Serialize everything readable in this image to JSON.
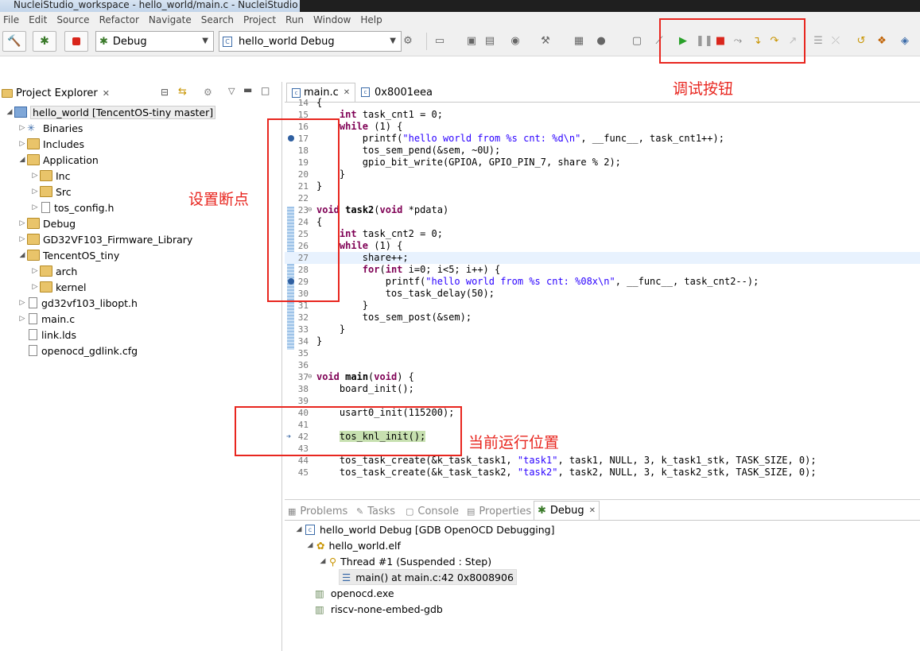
{
  "window": {
    "title": "NucleiStudio_workspace - hello_world/main.c - NucleiStudio"
  },
  "menu": [
    "File",
    "Edit",
    "Source",
    "Refactor",
    "Navigate",
    "Search",
    "Project",
    "Run",
    "Window",
    "Help"
  ],
  "toolbar": {
    "launch_mode": "Debug",
    "launch_config": "hello_world Debug",
    "icons": [
      "hammer-icon",
      "bug-icon",
      "stop-icon",
      "new-icon",
      "save-icon",
      "save-all-icon",
      "globe-icon",
      "build-icon",
      "binary-icon",
      "person-icon",
      "console-icon",
      "skip-breakpoints-icon",
      "resume-icon",
      "suspend-icon",
      "terminate-icon",
      "disconnect-icon",
      "step-into-icon",
      "step-over-icon",
      "step-return-icon",
      "instruction-step-icon",
      "drop-frame-icon",
      "restart-icon",
      "module-icon",
      "new-class-icon"
    ]
  },
  "explorer": {
    "title": "Project Explorer",
    "items": [
      {
        "label": "hello_world [TencentOS-tiny master]",
        "icon": "project"
      },
      {
        "label": "Binaries",
        "icon": "binaries"
      },
      {
        "label": "Includes",
        "icon": "includes"
      },
      {
        "label": "Application",
        "icon": "folder"
      },
      {
        "label": "Inc",
        "icon": "folder"
      },
      {
        "label": "Src",
        "icon": "folder"
      },
      {
        "label": "tos_config.h",
        "icon": "file"
      },
      {
        "label": "Debug",
        "icon": "folder"
      },
      {
        "label": "GD32VF103_Firmware_Library",
        "icon": "folder"
      },
      {
        "label": "TencentOS_tiny",
        "icon": "folder"
      },
      {
        "label": "arch",
        "icon": "folder"
      },
      {
        "label": "kernel",
        "icon": "folder"
      },
      {
        "label": "gd32vf103_libopt.h",
        "icon": "file"
      },
      {
        "label": "main.c",
        "icon": "file"
      },
      {
        "label": "link.lds",
        "icon": "file"
      },
      {
        "label": "openocd_gdlink.cfg",
        "icon": "file"
      }
    ]
  },
  "editor": {
    "tabs": [
      {
        "label": "main.c",
        "active": true
      },
      {
        "label": "0x8001eea",
        "active": false
      }
    ],
    "lines": [
      {
        "n": "14",
        "t": "{"
      },
      {
        "n": "15",
        "t": "    int task_cnt1 = 0;"
      },
      {
        "n": "16",
        "t": "    while (1) {"
      },
      {
        "n": "17",
        "t": "        printf(\"hello world from %s cnt: %d\\n\", __func__, task_cnt1++);"
      },
      {
        "n": "18",
        "t": "        tos_sem_pend(&sem, ~0U);"
      },
      {
        "n": "19",
        "t": "        gpio_bit_write(GPIOA, GPIO_PIN_7, share % 2);"
      },
      {
        "n": "20",
        "t": "    }"
      },
      {
        "n": "21",
        "t": "}"
      },
      {
        "n": "22",
        "t": ""
      },
      {
        "n": "23",
        "t": "void task2(void *pdata)"
      },
      {
        "n": "24",
        "t": "{"
      },
      {
        "n": "25",
        "t": "    int task_cnt2 = 0;"
      },
      {
        "n": "26",
        "t": "    while (1) {"
      },
      {
        "n": "27",
        "t": "        share++;"
      },
      {
        "n": "28",
        "t": "        for(int i=0; i<5; i++) {"
      },
      {
        "n": "29",
        "t": "            printf(\"hello world from %s cnt: %08x\\n\", __func__, task_cnt2--);"
      },
      {
        "n": "30",
        "t": "            tos_task_delay(50);"
      },
      {
        "n": "31",
        "t": "        }"
      },
      {
        "n": "32",
        "t": "        tos_sem_post(&sem);"
      },
      {
        "n": "33",
        "t": "    }"
      },
      {
        "n": "34",
        "t": "}"
      },
      {
        "n": "35",
        "t": ""
      },
      {
        "n": "36",
        "t": ""
      },
      {
        "n": "37",
        "t": "void main(void) {"
      },
      {
        "n": "38",
        "t": "    board_init();"
      },
      {
        "n": "39",
        "t": ""
      },
      {
        "n": "40",
        "t": "    usart0_init(115200);"
      },
      {
        "n": "41",
        "t": ""
      },
      {
        "n": "42",
        "t": "    tos_knl_init();"
      },
      {
        "n": "43",
        "t": ""
      },
      {
        "n": "44",
        "t": "    tos_task_create(&k_task_task1, \"task1\", task1, NULL, 3, k_task1_stk, TASK_SIZE, 0);"
      },
      {
        "n": "45",
        "t": "    tos_task_create(&k_task_task2, \"task2\", task2, NULL, 3, k_task2_stk, TASK_SIZE, 0);"
      }
    ]
  },
  "bottom": {
    "tabs": [
      "Problems",
      "Tasks",
      "Console",
      "Properties",
      "Debug"
    ],
    "active_tab": "Debug",
    "tree": [
      {
        "label": "hello_world Debug [GDB OpenOCD Debugging]"
      },
      {
        "label": "hello_world.elf"
      },
      {
        "label": "Thread #1 (Suspended : Step)"
      },
      {
        "label": "main() at main.c:42 0x8008906"
      },
      {
        "label": "openocd.exe"
      },
      {
        "label": "riscv-none-embed-gdb"
      }
    ]
  },
  "annotations": {
    "debug_buttons": "调试按钮",
    "set_breakpoint": "设置断点",
    "current_position": "当前运行位置"
  },
  "colors": {
    "annotation": "#e8261f",
    "current_line": "#c7e0b0",
    "highlight_line": "#e8f2fe"
  }
}
